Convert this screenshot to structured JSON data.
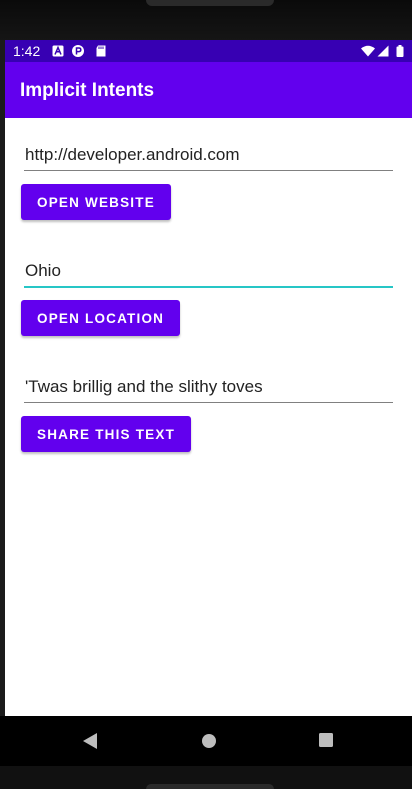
{
  "status_bar": {
    "time": "1:42",
    "left_icons": [
      "a-icon",
      "p-icon",
      "sd-card-icon"
    ],
    "right_icons": [
      "wifi-icon",
      "signal-icon",
      "battery-icon"
    ]
  },
  "app_bar": {
    "title": "Implicit Intents"
  },
  "form": {
    "website_field": {
      "value": "http://developer.android.com"
    },
    "website_button": "OPEN WEBSITE",
    "location_field": {
      "value": "Ohio"
    },
    "location_button": "OPEN LOCATION",
    "share_field": {
      "value": "'Twas brillig and the slithy toves"
    },
    "share_button": "SHARE THIS TEXT"
  },
  "nav_bar": {
    "icons": [
      "back-icon",
      "home-icon",
      "recents-icon"
    ]
  },
  "colors": {
    "status_bar": "#3700b3",
    "app_bar": "#6200ee",
    "button": "#6200ee",
    "focus_underline": "#26c6c6"
  }
}
